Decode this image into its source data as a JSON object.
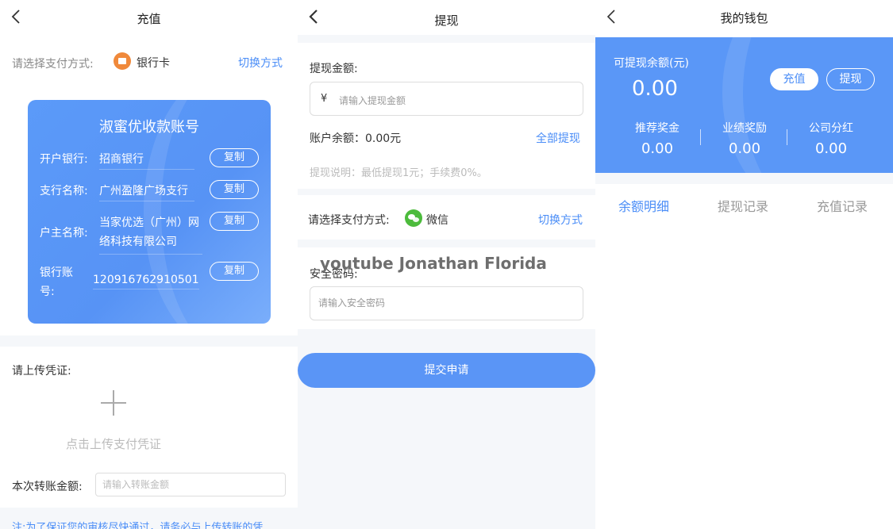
{
  "recharge": {
    "title": "充值",
    "pay_method_label": "请选择支付方式:",
    "pay_method_value": "银行卡",
    "switch_label": "切换方式",
    "card": {
      "title": "淑蜜优收款账号",
      "rows": [
        {
          "label": "开户银行:",
          "value": "招商银行"
        },
        {
          "label": "支行名称:",
          "value": "广州盈隆广场支行"
        },
        {
          "label": "户主名称:",
          "value": "当家优选（广州）网络科技有限公司"
        },
        {
          "label": "银行账号:",
          "value": "120916762910501"
        }
      ],
      "copy_label": "复制"
    },
    "upload_label": "请上传凭证:",
    "upload_hint": "点击上传支付凭证",
    "amount_label": "本次转账金额:",
    "amount_placeholder": "请输入转账金额",
    "note": "注:为了保证您的审核尽快通过，请务必与上传转账的凭"
  },
  "withdraw": {
    "title": "提现",
    "amount_label": "提现金额:",
    "currency": "¥",
    "amount_placeholder": "请输入提现金额",
    "balance": "账户余额：0.00元",
    "withdraw_all": "全部提现",
    "description": "提现说明：最低提现1元；手续费0%。",
    "pay_method_label": "请选择支付方式:",
    "pay_method_value": "微信",
    "switch_label": "切换方式",
    "password_label": "安全密码:",
    "password_placeholder": "请输入安全密码",
    "submit_label": "提交申请",
    "watermark": "youtube Jonathan Florida"
  },
  "wallet": {
    "title": "我的钱包",
    "available_label": "可提现余额(元)",
    "available_value": "0.00",
    "recharge_btn": "充值",
    "withdraw_btn": "提现",
    "stats": [
      {
        "label": "推荐奖金",
        "value": "0.00"
      },
      {
        "label": "业绩奖励",
        "value": "0.00"
      },
      {
        "label": "公司分红",
        "value": "0.00"
      }
    ],
    "tabs": [
      {
        "label": "余额明细",
        "active": true
      },
      {
        "label": "提现记录",
        "active": false
      },
      {
        "label": "充值记录",
        "active": false
      }
    ]
  },
  "colors": {
    "accent": "#4a8df7",
    "header_blue": "#5a97f7",
    "bank_icon": "#f0893b",
    "wechat_icon": "#4cbb3c"
  },
  "icons": [
    "back-arrow-icon",
    "bank-card-icon",
    "plus-icon",
    "wechat-icon"
  ]
}
